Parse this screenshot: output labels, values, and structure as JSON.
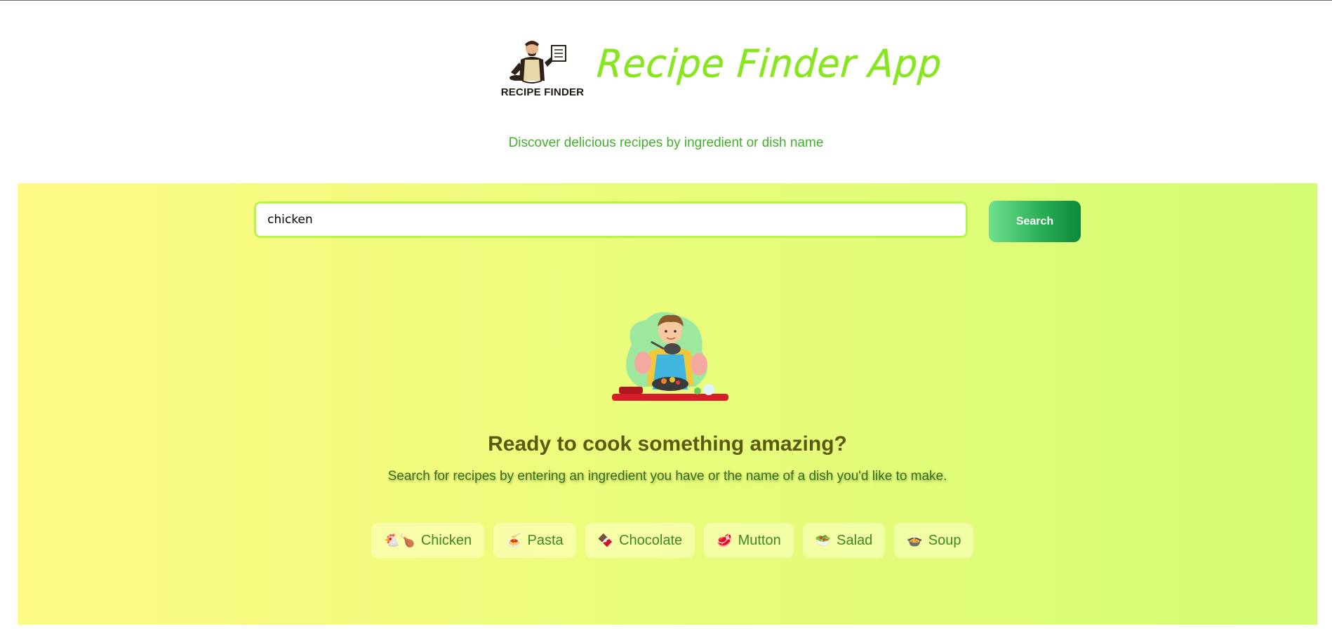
{
  "header": {
    "logo_text": "RECIPE FINDER",
    "title": "Recipe Finder App",
    "subtitle": "Discover delicious recipes by ingredient or dish name"
  },
  "search": {
    "value": "chicken",
    "button_label": "Search"
  },
  "empty_state": {
    "heading": "Ready to cook something amazing?",
    "description": "Search for recipes by entering an ingredient you have or the name of a dish you'd like to make."
  },
  "suggestions": [
    {
      "icon": "🐔🍗",
      "label": "Chicken",
      "icon_name": "chicken-icon"
    },
    {
      "icon": "🍝",
      "label": "Pasta",
      "icon_name": "pasta-icon"
    },
    {
      "icon": "🍫",
      "label": "Chocolate",
      "icon_name": "chocolate-icon"
    },
    {
      "icon": "🥩",
      "label": "Mutton",
      "icon_name": "meat-icon"
    },
    {
      "icon": "🥗",
      "label": "Salad",
      "icon_name": "salad-icon"
    },
    {
      "icon": "🍲",
      "label": "Soup",
      "icon_name": "soup-icon"
    }
  ],
  "colors": {
    "title": "#88e61e",
    "subtitle": "#3fb22a",
    "panel_gradient_start": "#fdfb84",
    "panel_gradient_end": "#d4fb74",
    "button_gradient_start": "#6fe08e",
    "button_gradient_end": "#0c8a3a",
    "heading": "#5b5a0e"
  }
}
